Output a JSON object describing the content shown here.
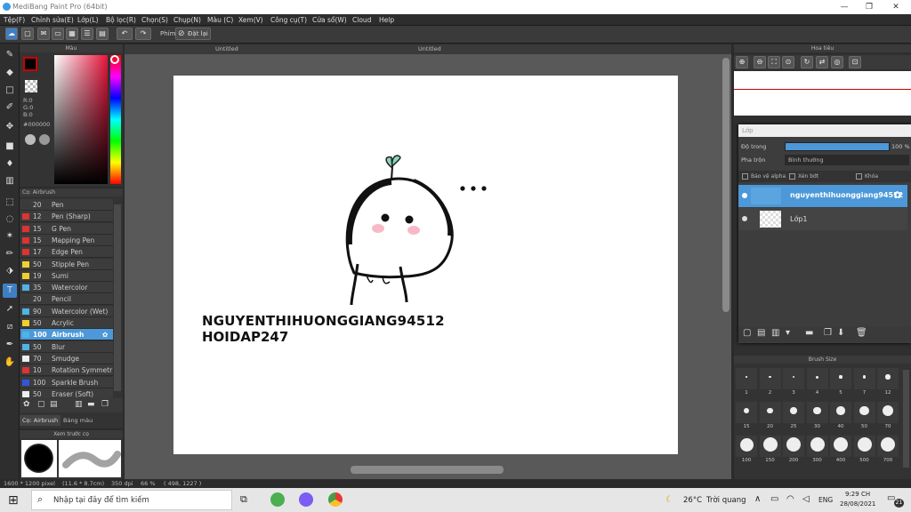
{
  "window": {
    "title": "MediBang Paint Pro (64bit)",
    "min": "—",
    "max": "❐",
    "close": "✕"
  },
  "menu": [
    "Tệp(F)",
    "Chỉnh sửa(E)",
    "Lớp(L)",
    "Bộ lọc(R)",
    "Chọn(S)",
    "Chụp(N)",
    "Màu (C)",
    "Xem(V)",
    "Công cụ(T)",
    "Cửa sổ(W)",
    "Cloud",
    "Help"
  ],
  "toolbar": {
    "hotkey_label": "Phím",
    "customize_label": "Đặt lại"
  },
  "tabs": [
    "Untitled",
    "Untitled"
  ],
  "color_panel": {
    "title": "Màu",
    "r": "R:0",
    "g": "G:0",
    "b": "B:0",
    "hex": "#000000"
  },
  "brush_panel": {
    "title": "Cọ: Airbrush",
    "items": [
      {
        "size": "20",
        "name": "Pen",
        "color": "#3a3a3a"
      },
      {
        "size": "12",
        "name": "Pen (Sharp)",
        "color": "#d33"
      },
      {
        "size": "15",
        "name": "G Pen",
        "color": "#d33"
      },
      {
        "size": "15",
        "name": "Mapping Pen",
        "color": "#d33"
      },
      {
        "size": "17",
        "name": "Edge Pen",
        "color": "#d33"
      },
      {
        "size": "50",
        "name": "Stipple Pen",
        "color": "#f0d030"
      },
      {
        "size": "19",
        "name": "Sumi",
        "color": "#f0d030"
      },
      {
        "size": "35",
        "name": "Watercolor",
        "color": "#4fb3e8"
      },
      {
        "size": "20",
        "name": "Pencil",
        "color": "#3a3a3a"
      },
      {
        "size": "90",
        "name": "Watercolor (Wet)",
        "color": "#4fb3e8"
      },
      {
        "size": "50",
        "name": "Acrylic",
        "color": "#f0d030"
      },
      {
        "size": "100",
        "name": "Airbrush",
        "color": "#4fb3e8"
      },
      {
        "size": "50",
        "name": "Blur",
        "color": "#4fb3e8"
      },
      {
        "size": "70",
        "name": "Smudge",
        "color": "#eee"
      },
      {
        "size": "10",
        "name": "Rotation Symmetr",
        "color": "#d33"
      },
      {
        "size": "100",
        "name": "Sparkle Brush",
        "color": "#3355dd"
      },
      {
        "size": "50",
        "name": "Eraser (Soft)",
        "color": "#eee"
      }
    ],
    "tab1": "Cọ: Airbrush",
    "tab2": "Bảng màu"
  },
  "preview_panel": {
    "title": "Xem trước cọ"
  },
  "navigator": {
    "title": "Hoa tiêu"
  },
  "layer_panel": {
    "title": "Lớp",
    "opacity_label": "Độ trong",
    "opacity_value": "100 %",
    "opacity_fraction": 1.0,
    "blend_label": "Pha trộn",
    "blend_value": "Bình thường",
    "protect_alpha": "Bảo vệ alpha",
    "clipping": "Xén bớt",
    "lock": "Khóa",
    "layers": [
      {
        "name": "nguyenthihuonggiang94512",
        "selected": true
      },
      {
        "name": "Lớp1",
        "selected": false
      }
    ]
  },
  "brush_size": {
    "title": "Brush Size",
    "sizes": [
      "1",
      "2",
      "3",
      "4",
      "5",
      "7",
      "12",
      "15",
      "20",
      "25",
      "30",
      "40",
      "50",
      "70",
      "100",
      "150",
      "200",
      "300",
      "400",
      "500",
      "700"
    ]
  },
  "canvas_text": {
    "line1": "NGUYENTHIHUONGGIANG94512",
    "line2": "HOIDAP247"
  },
  "status": {
    "dims": "1600 * 1200 pixel",
    "cm": "(11.6 * 8.7cm)",
    "dpi": "350 dpi",
    "zoom": "66 %",
    "coords": "( 498, 1227 )"
  },
  "taskbar": {
    "search_placeholder": "Nhập tại đây để tìm kiếm",
    "weather_temp": "26°C",
    "weather_desc": "Trời quang",
    "lang": "ENG",
    "time": "9:29 CH",
    "date": "28/08/2021",
    "notif_count": "21"
  }
}
